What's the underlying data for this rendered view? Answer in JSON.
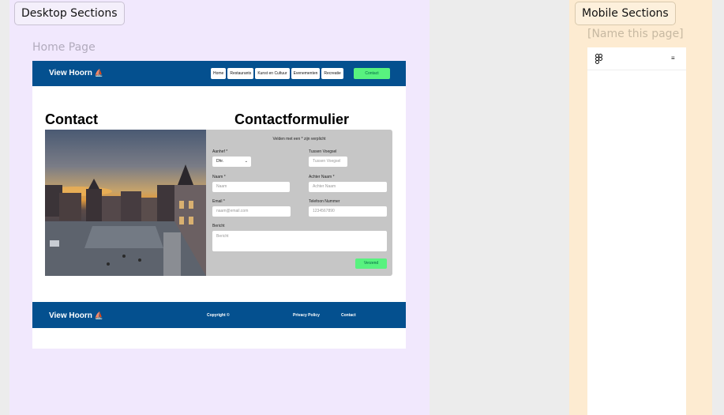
{
  "desktop": {
    "section_title": "Desktop Sections",
    "frame_title": "Home Page",
    "nav": {
      "brand": "View Hoorn",
      "links": [
        "Home",
        "Restaurants",
        "Kunst en Cultuur",
        "Evenementen",
        "Recreatie"
      ],
      "cta": "Contact"
    },
    "headings": {
      "contact": "Contact",
      "form": "Contactformulier"
    },
    "form": {
      "note": "Velden met een * zijn verplicht",
      "aanhef_label": "Aanhef *",
      "aanhef_value": "Dhr.",
      "tussen_label": "Tussen Voegsel",
      "tussen_placeholder": "Tussen Voegsel",
      "naam_label": "Naam *",
      "naam_placeholder": "Naam",
      "achternaam_label": "Achter Naam *",
      "achternaam_placeholder": "Achter Naam",
      "email_label": "Email *",
      "email_placeholder": "naam@email.com",
      "telefoon_label": "Telefoon Nummer",
      "telefoon_placeholder": "1234567890",
      "bericht_label": "Bericht",
      "bericht_placeholder": "Bericht",
      "submit": "Verzend"
    },
    "footer": {
      "brand": "View Hoorn",
      "copyright": "Copyright ©",
      "privacy": "Privacy Policy",
      "contact": "Contact"
    }
  },
  "mobile": {
    "section_title": "Mobile Sections",
    "frame_title": "[Name this page]",
    "menu_icon": "≡"
  },
  "colors": {
    "nav_blue": "#04508f",
    "cta_green": "#58f27f",
    "desktop_section_bg": "#f1e8fd",
    "mobile_section_bg": "#fdebd1"
  },
  "icons": {
    "boat": "⛵",
    "menu": "hamburger-icon",
    "logo": "figma-logo"
  }
}
